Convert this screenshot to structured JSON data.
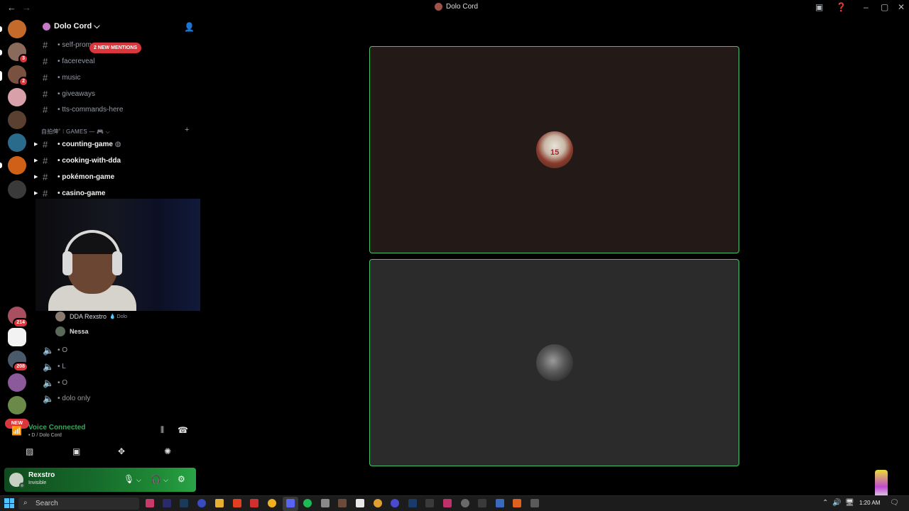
{
  "window": {
    "title": "Dolo Cord",
    "back_glyph": "←",
    "forward_glyph": "→"
  },
  "server_rail": {
    "badges": [
      "3",
      "2",
      "214",
      "208"
    ],
    "new_label": "NEW"
  },
  "guild": {
    "name": "Dolo Cord",
    "chevron": "⌵"
  },
  "channels_top": [
    {
      "name": "• self-promo",
      "icon": "hash-icon"
    },
    {
      "name": "• facereveal",
      "icon": "hash-icon"
    },
    {
      "name": "• music",
      "icon": "hash-icon"
    },
    {
      "name": "• giveaways",
      "icon": "hash-icon"
    },
    {
      "name": "• tts-commands-here",
      "icon": "hash-icon"
    }
  ],
  "mentions_pill": "2 NEW MENTIONS",
  "category": {
    "label": "自拍俾˚ ⁝ GAMES — 🎮 ⌵",
    "plus": "+"
  },
  "game_channels": [
    {
      "name": "• counting-game",
      "suffix": "◍"
    },
    {
      "name": "• cooking-with-dda",
      "suffix": ""
    },
    {
      "name": "• pokémon-game",
      "suffix": ""
    },
    {
      "name": "• casino-game",
      "suffix": ""
    }
  ],
  "voice_members": [
    {
      "name": "DDA Rexstro",
      "tag": "💧 Dolo"
    },
    {
      "name": "Nessa",
      "tag": ""
    }
  ],
  "voice_channels": [
    {
      "name": "• O"
    },
    {
      "name": "• L"
    },
    {
      "name": "• O"
    },
    {
      "name": "• dolo only"
    }
  ],
  "voice_panel": {
    "title": "Voice Connected",
    "subtitle": "• D / Dolo Cord"
  },
  "user_panel": {
    "username": "Rexstro",
    "status": "Invisible"
  },
  "stage": {
    "tile1_jersey": "15"
  },
  "taskbar": {
    "search_label": "Search",
    "time": "1:20 AM"
  },
  "colors": {
    "accent_green": "#3ba55d",
    "tile_border": "#47c26a",
    "mention_red": "#da373c"
  }
}
